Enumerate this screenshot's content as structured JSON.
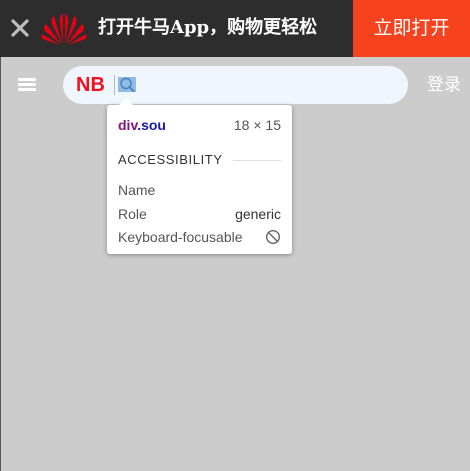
{
  "banner": {
    "promo_text": "打开牛马App，购物更轻松",
    "open_button_label": "立即打开",
    "close_icon": "close-icon",
    "logo_icon": "huawei-logo",
    "accent_color": "#f6421f"
  },
  "header": {
    "brand_logo_text": "NB",
    "login_label": "登录",
    "menu_icon": "menu-icon",
    "search_icon": "search-icon"
  },
  "inspector_tooltip": {
    "element_tag": "div",
    "element_class": ".sou",
    "size": "18 × 15",
    "section_title": "ACCESSIBILITY",
    "rows": [
      {
        "label": "Name",
        "value": ""
      },
      {
        "label": "Role",
        "value": "generic"
      },
      {
        "label": "Keyboard-focusable",
        "value": ""
      }
    ],
    "focusable_icon": "not-allowed-icon"
  }
}
